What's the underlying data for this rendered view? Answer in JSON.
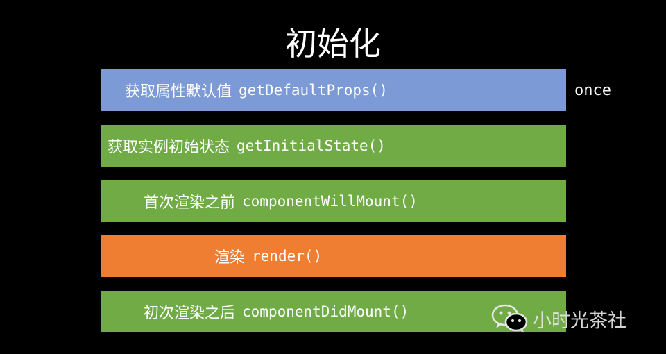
{
  "title": "初始化",
  "steps": [
    {
      "label": "获取属性默认值",
      "method": "getDefaultProps()",
      "color": "#7b9ad6"
    },
    {
      "label": "获取实例初始状态",
      "method": "getInitialState()",
      "color": "#70ab46"
    },
    {
      "label": "首次渲染之前",
      "method": "componentWillMount()",
      "color": "#70ab46"
    },
    {
      "label": "渲染",
      "method": "render()",
      "color": "#ef7e32"
    },
    {
      "label": "初次渲染之后",
      "method": "componentDidMount()",
      "color": "#70ab46"
    }
  ],
  "side_note": "once",
  "watermark": {
    "text": "小时光茶社",
    "icon": "wechat-icon"
  }
}
